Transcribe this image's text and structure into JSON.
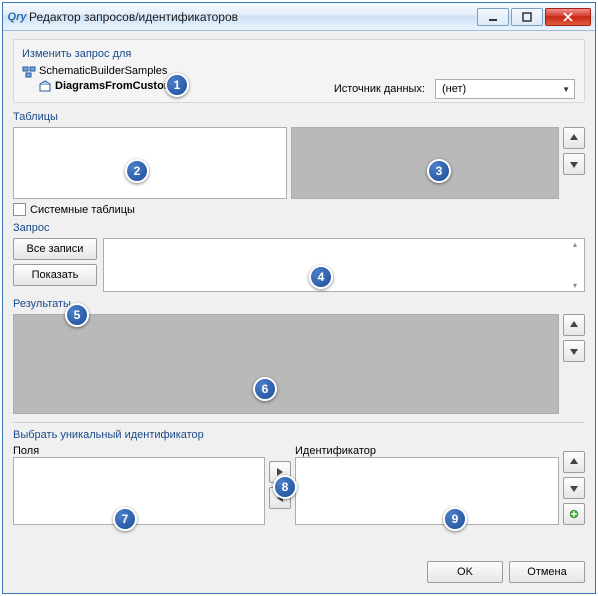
{
  "window": {
    "title": "Редактор запросов/идентификаторов",
    "min_label": "–",
    "max_label": "▢",
    "close_label": "✕"
  },
  "group_change": {
    "label": "Изменить запрос для",
    "tree": {
      "root": "SchematicBuilderSamples",
      "child": "DiagramsFromCustom"
    },
    "datasource_label": "Источник данных:",
    "datasource_value": "(нет)"
  },
  "tables": {
    "label": "Таблицы",
    "system_tables_label": "Системные таблицы"
  },
  "query": {
    "label": "Запрос",
    "all_records_btn": "Все записи",
    "show_btn": "Показать"
  },
  "results": {
    "label": "Результаты"
  },
  "uid": {
    "label": "Выбрать уникальный идентификатор",
    "fields_label": "Поля",
    "ident_label": "Идентификатор"
  },
  "footer": {
    "ok": "OK",
    "cancel": "Отмена"
  },
  "icons": {
    "up": "up-arrow-icon",
    "down": "down-arrow-icon",
    "right": "right-arrow-icon",
    "left": "left-arrow-icon",
    "add": "add-icon"
  },
  "callouts": [
    "1",
    "2",
    "3",
    "4",
    "5",
    "6",
    "7",
    "8",
    "9"
  ]
}
